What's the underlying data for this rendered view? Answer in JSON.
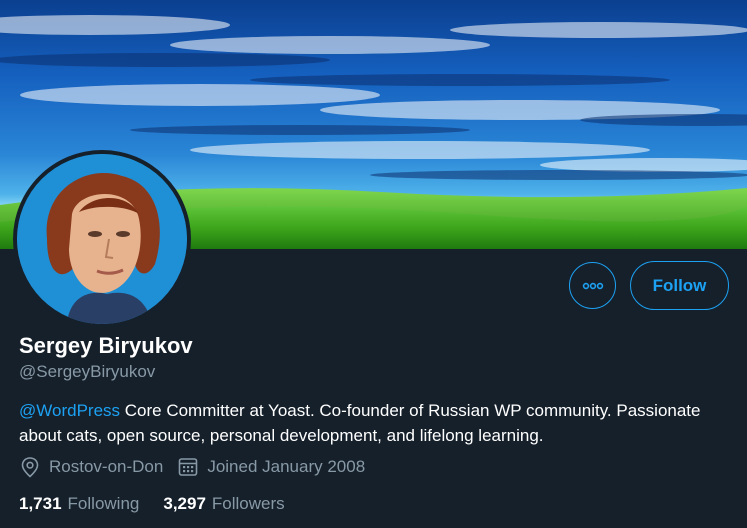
{
  "profile": {
    "name": "Sergey Biryukov",
    "handle": "@SergeyBiryukov",
    "bio_mention": "@WordPress",
    "bio_text": " Core Committer at Yoast. Co-founder of Russian WP community. Passionate about cats, open source, personal development, and lifelong learning.",
    "location": "Rostov-on-Don",
    "joined": "Joined January 2008",
    "following_count": "1,731",
    "following_label": "Following",
    "followers_count": "3,297",
    "followers_label": "Followers"
  },
  "actions": {
    "follow_label": "Follow",
    "more_icon": "more-dots-icon"
  },
  "icons": {
    "location": "location-pin-icon",
    "calendar": "calendar-icon"
  },
  "colors": {
    "background": "#15202b",
    "accent": "#1da1f2",
    "secondary_text": "#8899a6"
  }
}
